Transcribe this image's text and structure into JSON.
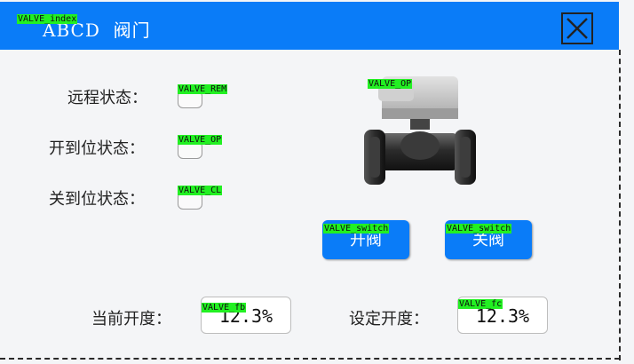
{
  "title": {
    "device_name": "ABCD",
    "section": "阀门",
    "index_tag": "VALVE_index"
  },
  "close_icon": "close-icon",
  "status": [
    {
      "label": "远程状态：",
      "tag": "VALVE_REM"
    },
    {
      "label": "开到位状态：",
      "tag": "VALVE_OP"
    },
    {
      "label": "关到位状态：",
      "tag": "VALVE_CL"
    }
  ],
  "valve_image": {
    "tag": "VALVE_OP",
    "icon": "valve-icon"
  },
  "buttons": {
    "open": {
      "label": "开阀",
      "tag": "VALVE_switch"
    },
    "close": {
      "label": "关阀",
      "tag": "VALVE_switch"
    }
  },
  "opening": {
    "current": {
      "label": "当前开度：",
      "value": "12.3%",
      "tag": "VALVE_fb"
    },
    "setpoint": {
      "label": "设定开度：",
      "value": "12.3%",
      "tag": "VALVE_fc"
    }
  },
  "colors": {
    "accent": "#0a7cf8",
    "tag_bg": "#22f022",
    "panel_bg": "#f4f5f7"
  }
}
